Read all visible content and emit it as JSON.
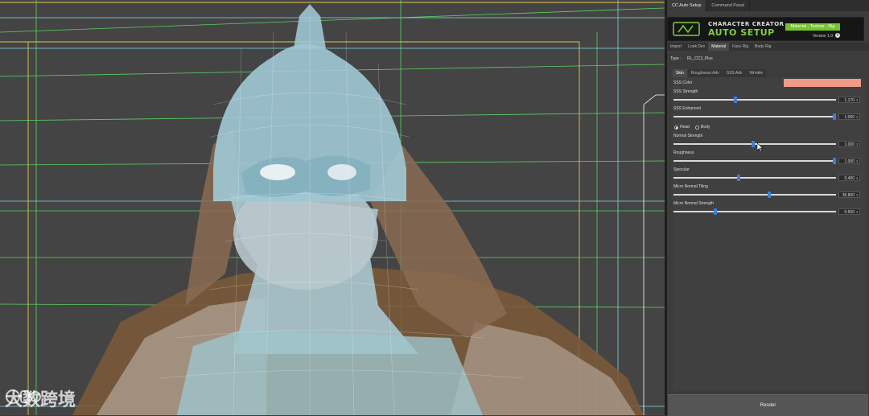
{
  "viewport": {
    "description_hidden": "",
    "colors": {
      "background": "#444444",
      "wire_white": "#e8e8e8",
      "wire_cyan": "#7fd8e4",
      "wire_green": "#5ee067",
      "wire_yellow": "#e2c84a",
      "skin_tone": "#a8c8d0",
      "leather": "#7a5a3a"
    }
  },
  "watermark": {
    "text": "大数跨境"
  },
  "panel": {
    "tabs": [
      "CC Auto Setup",
      "Command Panel"
    ],
    "active_tab": 0,
    "banner": {
      "line1": "CHARACTER CREATOR",
      "line2": "AUTO SETUP",
      "badge": "Material : Texture : Rig",
      "version": "Version 1.0",
      "info_icon": "i"
    },
    "subtabs": [
      "Import",
      "Look Dev",
      "Material",
      "Face Rig",
      "Body Rig"
    ],
    "active_subtab": 2,
    "type": {
      "label": "Type :",
      "value": "RL_CC3_Plus"
    },
    "material_tabs": [
      "Skin",
      "Roughness Adv",
      "SSS Adv",
      "Wrinkle"
    ],
    "active_material_tab": 0,
    "sss_color": {
      "label": "SSS Color",
      "color": "#f09a8a"
    },
    "sliders": [
      {
        "label": "SSS Strength",
        "value": "1.170",
        "fraction": 0.38
      },
      {
        "label": "SSS Enhanced",
        "value": "1.000",
        "fraction": 1.0
      },
      {
        "label": "Normal Strength",
        "value": "1.000",
        "fraction": 0.49
      },
      {
        "label": "Roughness",
        "value": "1.000",
        "fraction": 1.0
      },
      {
        "label": "Specular",
        "value": "0.400",
        "fraction": 0.4
      },
      {
        "label": "Micro Normal Tiling",
        "value": "36.800",
        "fraction": 0.59
      },
      {
        "label": "Micro Normal Strength",
        "value": "0.500",
        "fraction": 0.25
      }
    ],
    "radios": {
      "head": "Head",
      "body": "Body",
      "selected": "Head"
    },
    "render_button": "Render",
    "accent_color": "#3b7fd9",
    "brand_color": "#76c22f"
  }
}
